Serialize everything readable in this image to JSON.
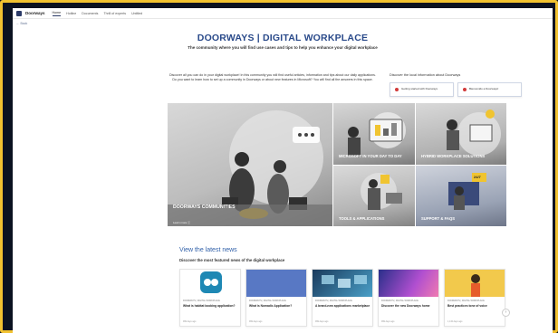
{
  "topnav": {
    "site_name": "Doorways",
    "items": [
      "Home",
      "Hotline",
      "Documents",
      "Thrill of experts",
      "Untitled"
    ]
  },
  "back_label": "← Back",
  "header": {
    "title": "DOORWAYS | DIGITAL WORKPLACE",
    "subtitle": "The community where you will find use cases and tips to help you enhance your digital workplace"
  },
  "intro": "Discover all you can do in your digital workplace! In this community you will find useful articles, information and tips about our daily applications. Do you want to learn how to set up a community in Doorways or about new features in Microsoft? You will find all the answers in this space.",
  "local": {
    "heading": "Discover the local information about Doorways",
    "links": [
      {
        "label": "Getting started with Doorways"
      },
      {
        "label": "Bienvenido a Doorways!"
      }
    ]
  },
  "hero": {
    "main_label": "DOORWAYS COMMUNITIES",
    "learn_more": "Learn more ⓘ",
    "tiles": [
      {
        "label": "MICROSOFT IN YOUR DAY TO DAY"
      },
      {
        "label": "HYBRID WORKPLACE SOLUTIONS"
      },
      {
        "label": "TOOLS & APPLICATIONS"
      },
      {
        "label": "SUPPORT & FAQs"
      }
    ],
    "badge": "24/7"
  },
  "news": {
    "title": "View the latest news",
    "subtitle": "Discover the most featured news of the digital workplace",
    "cards": [
      {
        "category": "DOORWAYS | DIGITAL WORKPLACE",
        "title": "What is habitat booking application?",
        "time": "999 days ago"
      },
      {
        "category": "DOORWAYS | DIGITAL WORKPLACE",
        "title": "What is Nomadic Application?",
        "time": "999 days ago"
      },
      {
        "category": "DOORWAYS | DIGITAL WORKPLACE",
        "title": "A brand-new applications marketplace",
        "time": "999 days ago"
      },
      {
        "category": "DOORWAYS | DIGITAL WORKPLACE",
        "title": "Discover the new Doorways home",
        "time": "999 days ago"
      },
      {
        "category": "DOORWAYS | DIGITAL WORKPLACE",
        "title": "Best practices tone of voice",
        "time": "1,132 days ago"
      }
    ]
  },
  "colors": {
    "frame": "#f2c230",
    "title_blue": "#2a4a8a",
    "news_blue": "#2f5fa8"
  }
}
